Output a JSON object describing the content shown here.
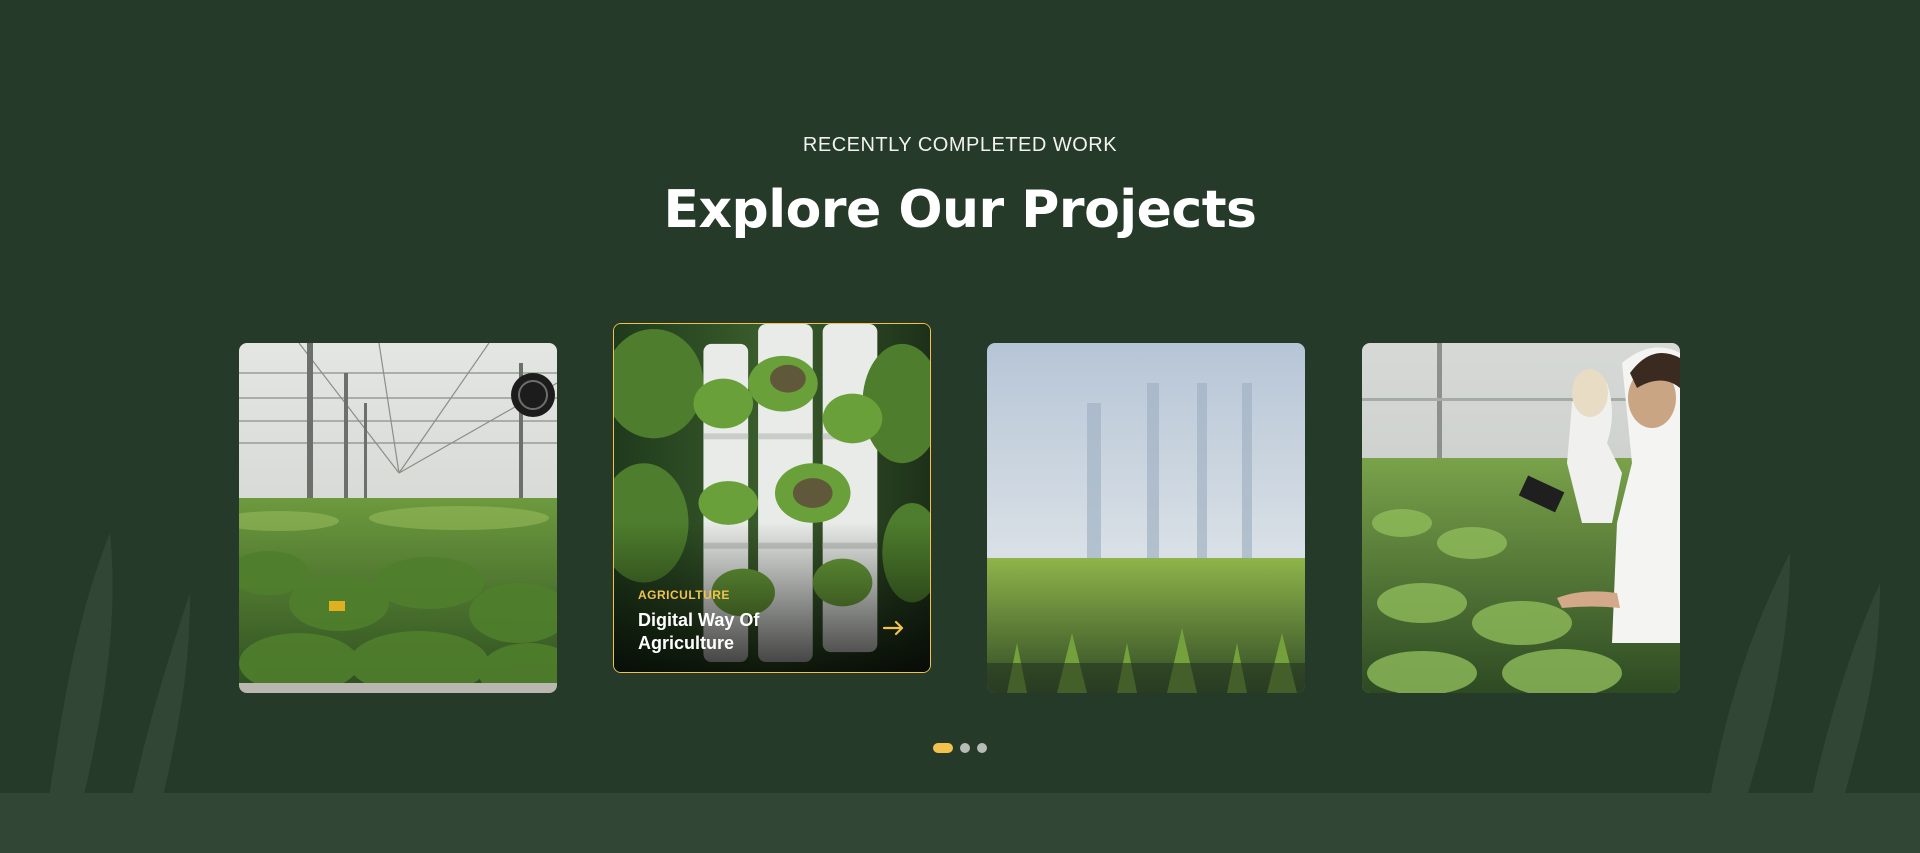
{
  "section": {
    "eyebrow": "RECENTLY COMPLETED WORK",
    "heading": "Explore Our Projects"
  },
  "colors": {
    "background": "#253a28",
    "accent": "#f2c14e",
    "dot_inactive": "#b7bcb7"
  },
  "projects": [
    {
      "image": "greenhouse-broccoli-rows"
    },
    {
      "image": "vertical-hydroponic-towers",
      "category": "Agriculture",
      "title": "Digital Way Of Agriculture",
      "arrow_icon": "arrow-right-icon"
    },
    {
      "image": "blurred-greenhouse-seedlings"
    },
    {
      "image": "scientists-inspecting-plants"
    }
  ],
  "pagination": {
    "count": 3,
    "active_index": 0
  }
}
